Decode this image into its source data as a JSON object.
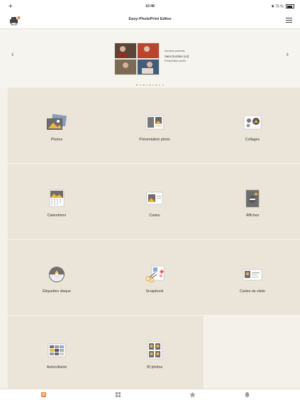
{
  "status": {
    "time": "10:48",
    "battery": "75 %"
  },
  "app": {
    "title": "Easy-PhotoPrint Editor"
  },
  "banner": {
    "line1": "Derniers présents",
    "line2": "Sans bordure (x4)",
    "line3": "Présentation photo",
    "page_count": 9,
    "active_page": 0
  },
  "tiles": [
    {
      "label": "Photos",
      "icon": "photos-icon"
    },
    {
      "label": "Présentation photo",
      "icon": "photo-layout-icon"
    },
    {
      "label": "Collages",
      "icon": "collages-icon"
    },
    {
      "label": "Calendriers",
      "icon": "calendar-icon"
    },
    {
      "label": "Cartes",
      "icon": "cards-icon"
    },
    {
      "label": "Affiches",
      "icon": "posters-icon"
    },
    {
      "label": "Étiquettes disque",
      "icon": "disc-label-icon"
    },
    {
      "label": "Scrapbook",
      "icon": "scrapbook-icon"
    },
    {
      "label": "Cartes de visite",
      "icon": "business-card-icon"
    },
    {
      "label": "Autocollants",
      "icon": "stickers-icon"
    },
    {
      "label": "ID photos",
      "icon": "id-photos-icon"
    }
  ],
  "tabs": [
    {
      "name": "home-tab-icon",
      "active": true
    },
    {
      "name": "grid-tab-icon",
      "active": false
    },
    {
      "name": "favorites-tab-icon",
      "active": false
    },
    {
      "name": "notifications-tab-icon",
      "active": false
    }
  ],
  "colors": {
    "accent": "#e8873a",
    "tile_bg": "#ebe5d9",
    "page_bg": "#f4f1ea"
  }
}
